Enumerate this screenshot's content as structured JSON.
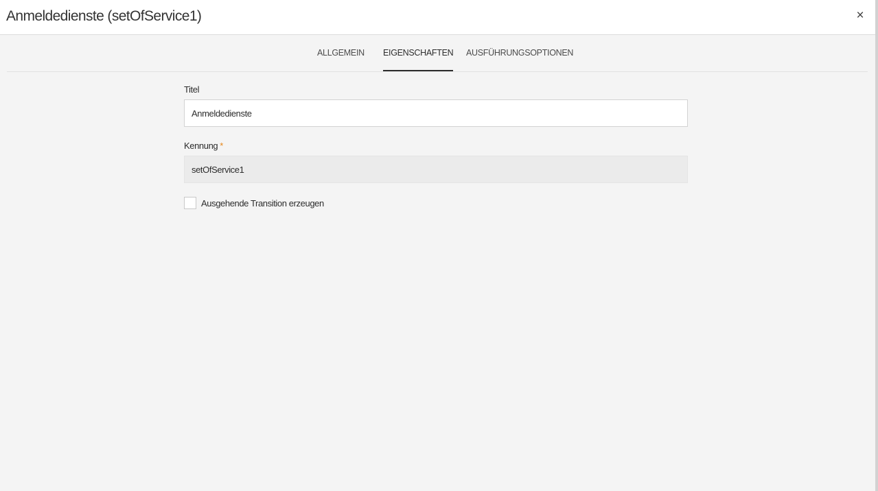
{
  "dialog": {
    "title": "Anmeldedienste (setOfService1)",
    "close_icon": "close-icon",
    "close_glyph": "×"
  },
  "tabs": [
    {
      "label": "ALLGEMEIN",
      "active": false
    },
    {
      "label": "EIGENSCHAFTEN",
      "active": true
    },
    {
      "label": "AUSFÜHRUNGSOPTIONEN",
      "active": false
    }
  ],
  "form": {
    "title_field": {
      "label": "Titel",
      "value": "Anmeldedienste"
    },
    "id_field": {
      "label": "Kennung",
      "required_marker": "*",
      "value": "setOfService1"
    },
    "outgoing_transition": {
      "label": "Ausgehende Transition erzeugen",
      "checked": false
    }
  },
  "colors": {
    "required_star": "#e68619",
    "background": "#f4f4f4",
    "active_tab_underline": "#2c2c2c"
  }
}
